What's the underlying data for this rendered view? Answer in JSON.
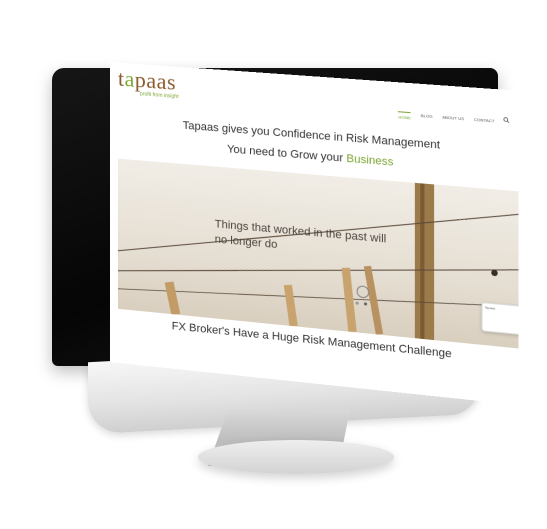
{
  "site": {
    "logo_prefix": "t",
    "logo_accent": "a",
    "logo_rest": "paas",
    "tagline": "profit from insight"
  },
  "nav": {
    "items": [
      {
        "label": "HOME",
        "active": true
      },
      {
        "label": "BLOG",
        "active": false
      },
      {
        "label": "ABOUT US",
        "active": false
      },
      {
        "label": "CONTACT",
        "active": false
      }
    ]
  },
  "hero_text": {
    "line1": "Tapaas gives you Confidence in Risk Management",
    "line2_prefix": "You need to Grow your ",
    "line2_accent": "Business"
  },
  "slider": {
    "caption_line1": "Things that worked in the past will",
    "caption_line2": "no longer do"
  },
  "chat": {
    "title": "Tapaas"
  },
  "section": {
    "heading": "FX Broker's Have a Huge Risk Management Challenge"
  },
  "colors": {
    "brand_green": "#7ea734",
    "brand_brown": "#8a5a2b",
    "bezel": "#0a0a0a"
  }
}
